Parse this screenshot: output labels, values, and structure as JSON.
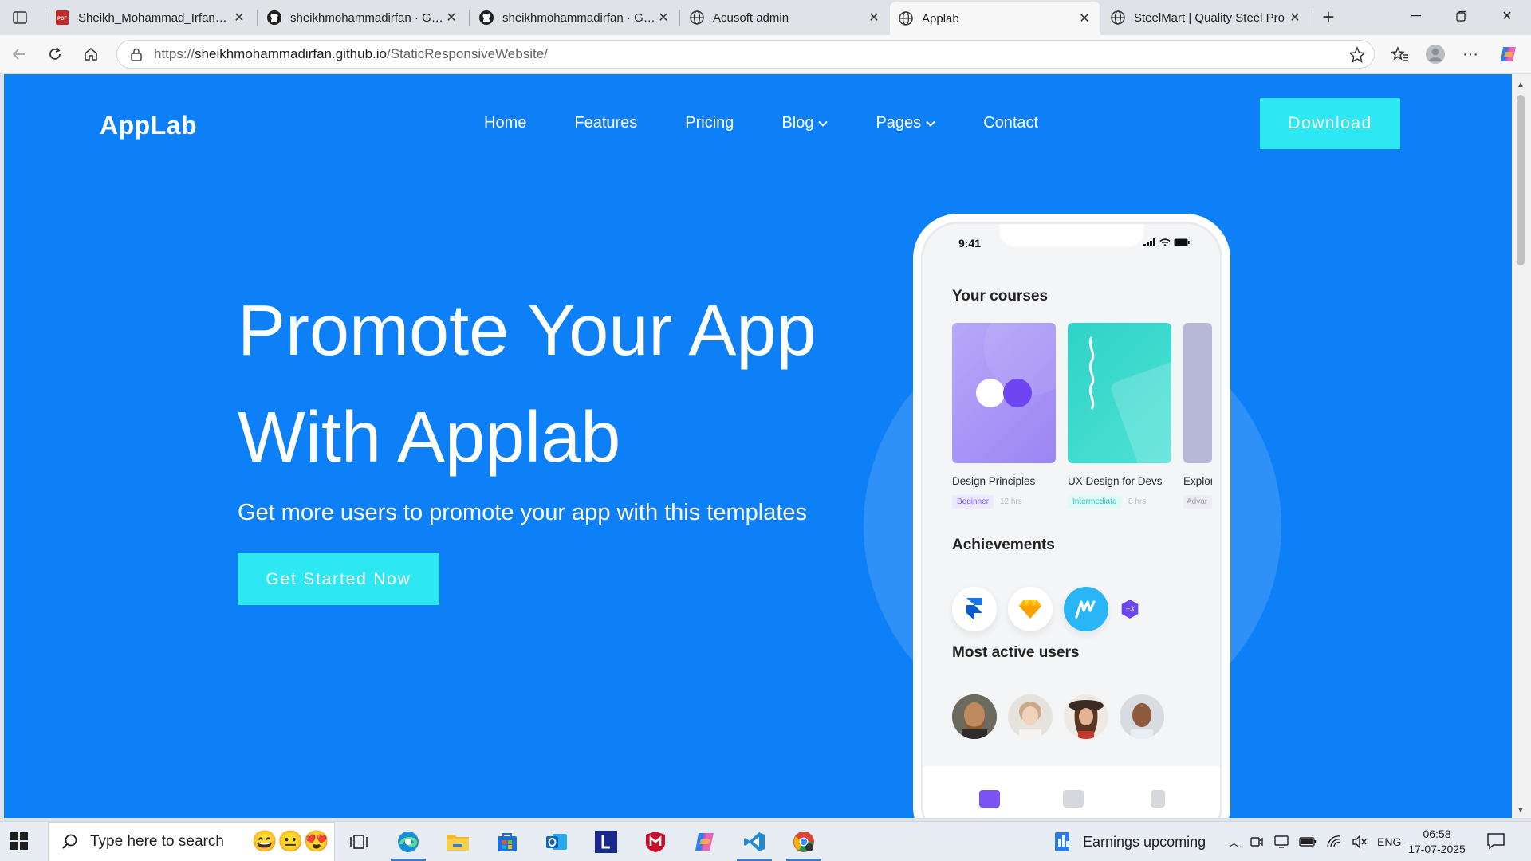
{
  "browser": {
    "tabs": [
      {
        "title": "Sheikh_Mohammad_Irfan_CS",
        "favicon": "pdf-icon",
        "active": false
      },
      {
        "title": "sheikhmohammadirfan · GitHub",
        "favicon": "github-icon",
        "active": false
      },
      {
        "title": "sheikhmohammadirfan · GitHub",
        "favicon": "github-icon",
        "active": false
      },
      {
        "title": "Acusoft admin",
        "favicon": "globe-icon",
        "active": false
      },
      {
        "title": "Applab",
        "favicon": "globe-icon",
        "active": true
      },
      {
        "title": "SteelMart | Quality Steel Pro",
        "favicon": "globe-icon",
        "active": false
      }
    ],
    "url": {
      "scheme": "https://",
      "host": "sheikhmohammadirfan.github.io",
      "path": "/StaticResponsiveWebsite/"
    }
  },
  "site": {
    "logo": "AppLab",
    "nav": [
      {
        "label": "Home",
        "dropdown": false
      },
      {
        "label": "Features",
        "dropdown": false
      },
      {
        "label": "Pricing",
        "dropdown": false
      },
      {
        "label": "Blog",
        "dropdown": true
      },
      {
        "label": "Pages",
        "dropdown": true
      },
      {
        "label": "Contact",
        "dropdown": false
      }
    ],
    "download_label": "Download",
    "hero": {
      "title_line1": "Promote Your App",
      "title_line2": "With Applab",
      "subtitle": "Get more users to promote your app with this templates",
      "cta_label": "Get Started Now"
    },
    "colors": {
      "page_bg": "#0d7ff7",
      "accent": "#2de7f2"
    }
  },
  "phone": {
    "time": "9:41",
    "courses_heading": "Your courses",
    "courses": [
      {
        "name": "Design Principles",
        "tag": "Beginner",
        "hours": "12 hrs"
      },
      {
        "name": "UX Design for Devs",
        "tag": "Intermediate",
        "hours": "8 hrs"
      },
      {
        "name": "Explor",
        "tag": "Advar",
        "hours": ""
      }
    ],
    "achievements_heading": "Achievements",
    "achievements_more": "+3",
    "active_users_heading": "Most active users"
  },
  "taskbar": {
    "search_placeholder": "Type here to search",
    "weather": "Earnings upcoming",
    "language": "ENG",
    "time": "06:58",
    "date": "17-07-2025"
  }
}
